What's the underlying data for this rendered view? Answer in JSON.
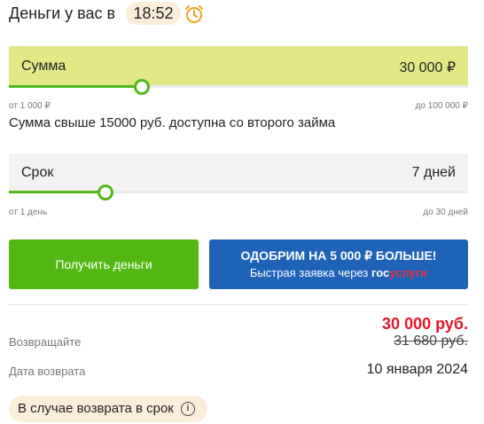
{
  "header": {
    "label": "Деньги у вас в",
    "time": "18:52",
    "alarm_icon": "alarm-clock-icon"
  },
  "amount_slider": {
    "label": "Сумма",
    "value": "30 000 ₽",
    "min_label": "от 1 000 ₽",
    "max_label": "до 100 000 ₽",
    "level": 0.29
  },
  "note": "Сумма свыше 15000 руб. доступна со второго займа",
  "term_slider": {
    "label": "Срок",
    "value": "7 дней",
    "min_label": "от 1 день",
    "max_label": "до 30 дней",
    "level": 0.21
  },
  "buttons": {
    "get_money": "Получить деньги",
    "promo_title": "ОДОБРИМ НА 5 000 ₽ БОЛЬШЕ!",
    "promo_sub_prefix": "Быстрая заявка через ",
    "promo_brand_a": "гос",
    "promo_brand_b": "услуги"
  },
  "summary": {
    "return_label": "Возвращайте",
    "return_amount": "30 000 руб.",
    "old_amount": "31 680 руб.",
    "date_label": "Дата возврата",
    "date_value": "10 января 2024"
  },
  "footer_pill": {
    "label": "В случае возврата в срок",
    "icon": "info-icon"
  },
  "colors": {
    "accent_green": "#52b913",
    "promo_blue": "#1e63b8",
    "price_red": "#e0162b",
    "highlight_yellow": "#e3e887"
  }
}
